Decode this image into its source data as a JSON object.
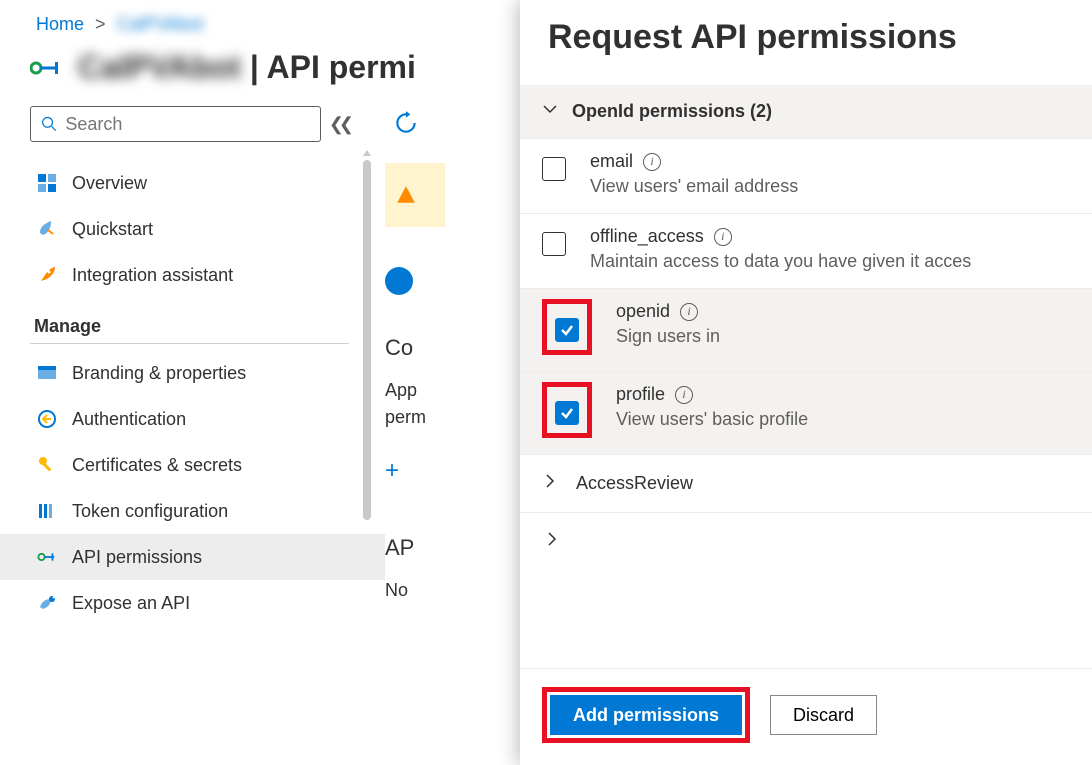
{
  "breadcrumb": {
    "home": "Home",
    "app_name": "CalPVAbot"
  },
  "page": {
    "title_app": "CalPVAbot",
    "title_suffix": " | API permi"
  },
  "search": {
    "placeholder": "Search"
  },
  "nav": {
    "overview": "Overview",
    "quickstart": "Quickstart",
    "integration": "Integration assistant",
    "manage_label": "Manage",
    "branding": "Branding & properties",
    "authentication": "Authentication",
    "certificates": "Certificates & secrets",
    "token": "Token configuration",
    "api_permissions": "API permissions",
    "expose": "Expose an API"
  },
  "main": {
    "configured_heading": "Co",
    "configured_text1": "App",
    "configured_text2": "perm",
    "add_text": "",
    "section2_heading": "AP",
    "section2_text": "No"
  },
  "panel": {
    "title": "Request API permissions",
    "group_label": "OpenId permissions (2)",
    "permissions": [
      {
        "name": "email",
        "desc": "View users' email address",
        "checked": false,
        "highlight": false
      },
      {
        "name": "offline_access",
        "desc": "Maintain access to data you have given it acces",
        "checked": false,
        "highlight": false
      },
      {
        "name": "openid",
        "desc": "Sign users in",
        "checked": true,
        "highlight": true
      },
      {
        "name": "profile",
        "desc": "View users' basic profile",
        "checked": true,
        "highlight": true
      }
    ],
    "collapsed_group": "AccessReview",
    "add_btn": "Add permissions",
    "discard_btn": "Discard"
  }
}
